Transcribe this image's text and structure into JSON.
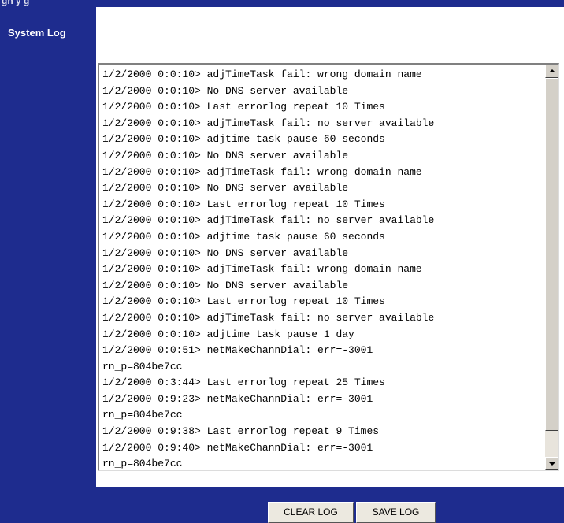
{
  "header": {
    "partial_title": "gn    y        g"
  },
  "sidebar": {
    "title": "System Log"
  },
  "log": {
    "text": "1/2/2000 0:0:10> adjTimeTask fail: wrong domain name\n1/2/2000 0:0:10> No DNS server available\n1/2/2000 0:0:10> Last errorlog repeat 10 Times\n1/2/2000 0:0:10> adjTimeTask fail: no server available\n1/2/2000 0:0:10> adjtime task pause 60 seconds\n1/2/2000 0:0:10> No DNS server available\n1/2/2000 0:0:10> adjTimeTask fail: wrong domain name\n1/2/2000 0:0:10> No DNS server available\n1/2/2000 0:0:10> Last errorlog repeat 10 Times\n1/2/2000 0:0:10> adjTimeTask fail: no server available\n1/2/2000 0:0:10> adjtime task pause 60 seconds\n1/2/2000 0:0:10> No DNS server available\n1/2/2000 0:0:10> adjTimeTask fail: wrong domain name\n1/2/2000 0:0:10> No DNS server available\n1/2/2000 0:0:10> Last errorlog repeat 10 Times\n1/2/2000 0:0:10> adjTimeTask fail: no server available\n1/2/2000 0:0:10> adjtime task pause 1 day\n1/2/2000 0:0:51> netMakeChannDial: err=-3001\nrn_p=804be7cc\n1/2/2000 0:3:44> Last errorlog repeat 25 Times\n1/2/2000 0:9:23> netMakeChannDial: err=-3001\nrn_p=804be7cc\n1/2/2000 0:9:38> Last errorlog repeat 9 Times\n1/2/2000 0:9:40> netMakeChannDial: err=-3001\nrn_p=804be7cc"
  },
  "buttons": {
    "clear_label": "CLEAR LOG",
    "save_label": "SAVE LOG"
  },
  "colors": {
    "accent": "#1e2c8e",
    "button_face": "#ece9e0"
  },
  "icons": {
    "scroll_up": "triangle-up",
    "scroll_down": "triangle-down"
  }
}
